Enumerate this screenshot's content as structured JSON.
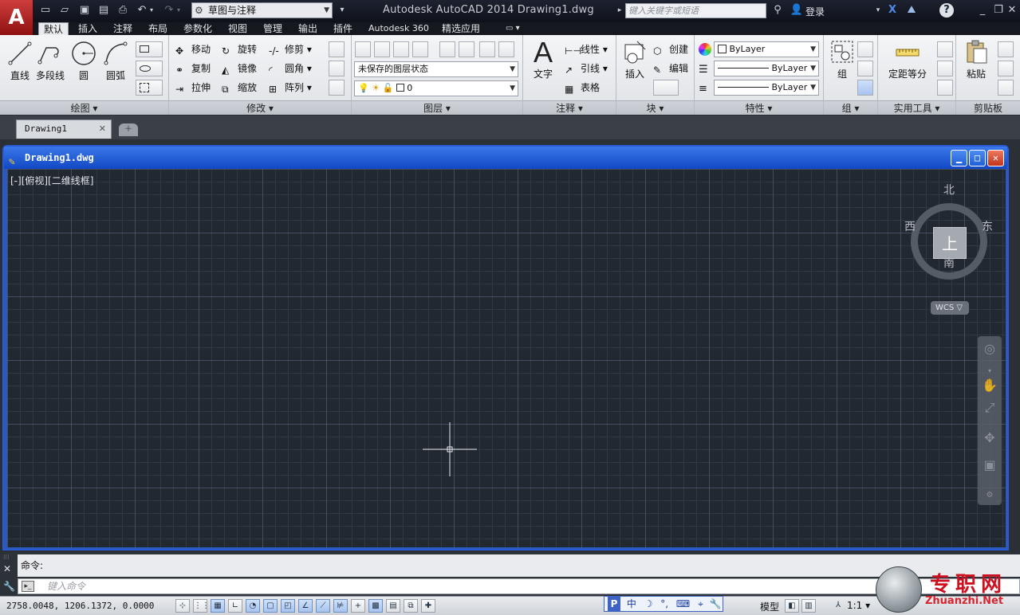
{
  "app": {
    "title": "Autodesk AutoCAD 2014   Drawing1.dwg",
    "logo": "A",
    "workspace": "草图与注释",
    "search_placeholder": "键入关键字或短语",
    "login": "登录",
    "help": "?"
  },
  "menu_tabs": [
    "默认",
    "插入",
    "注释",
    "布局",
    "参数化",
    "视图",
    "管理",
    "输出",
    "插件",
    "Autodesk 360",
    "精选应用"
  ],
  "ribbon": {
    "draw": {
      "title": "绘图 ▾",
      "big": [
        "直线",
        "多段线",
        "圆",
        "圆弧"
      ]
    },
    "modify": {
      "title": "修改 ▾",
      "items": [
        "移动",
        "旋转",
        "修剪",
        "复制",
        "镜像",
        "圆角",
        "拉伸",
        "缩放",
        "阵列"
      ]
    },
    "layers": {
      "title": "图层 ▾",
      "state": "未保存的图层状态",
      "current": "0"
    },
    "annotation": {
      "title": "注释 ▾",
      "big": "文字",
      "items": [
        "线性",
        "引线",
        "表格"
      ]
    },
    "block": {
      "title": "块 ▾",
      "big": "插入",
      "items": [
        "创建",
        "编辑"
      ]
    },
    "properties": {
      "title": "特性 ▾",
      "color": "ByLayer",
      "linetype": "ByLayer",
      "lineweight": "ByLayer"
    },
    "groups": {
      "title": "组 ▾",
      "big": "组"
    },
    "utilities": {
      "title": "实用工具 ▾",
      "big": "定距等分"
    },
    "clipboard": {
      "title": "剪贴板",
      "big": "粘贴"
    }
  },
  "doc_tab": "Drawing1",
  "drawing_window": {
    "title": "Drawing1.dwg",
    "view_label": "[-][俯视][二维线框]"
  },
  "viewcube": {
    "north": "北",
    "south": "南",
    "west": "西",
    "east": "东",
    "face": "上",
    "wcs": "WCS ▽"
  },
  "command": {
    "history": "命令:",
    "placeholder": "键入命令"
  },
  "status": {
    "coords": "2758.0048,  1206.1372,  0.0000",
    "model": "模型",
    "scale": "1:1 ▾",
    "ime": [
      "中",
      "☽",
      "°,",
      "⌨",
      "⌖",
      "🔧"
    ]
  },
  "watermark": {
    "text": "专职网",
    "url": "Zhuanzhi.Net"
  }
}
